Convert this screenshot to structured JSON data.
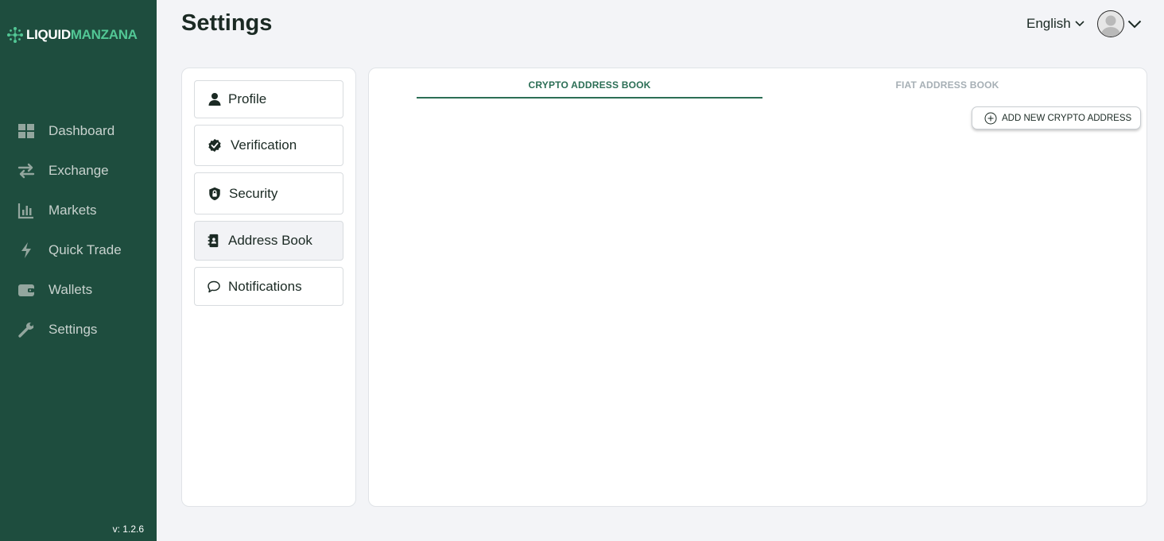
{
  "brand": {
    "part1": "LIQUID",
    "part2": "MANZANA",
    "accent": "#52c795",
    "sidebar_bg": "#1e4d3e"
  },
  "sidebar": {
    "items": [
      {
        "label": "Dashboard",
        "icon": "dashboard-icon"
      },
      {
        "label": "Exchange",
        "icon": "exchange-icon"
      },
      {
        "label": "Markets",
        "icon": "markets-icon"
      },
      {
        "label": "Quick Trade",
        "icon": "lightning-icon"
      },
      {
        "label": "Wallets",
        "icon": "wallet-icon"
      },
      {
        "label": "Settings",
        "icon": "wrench-icon"
      }
    ],
    "version": "v: 1.2.6"
  },
  "header": {
    "title": "Settings",
    "language": "English"
  },
  "settings_menu": {
    "items": [
      {
        "label": "Profile",
        "icon": "user-icon"
      },
      {
        "label": "Verification",
        "icon": "verified-badge-icon"
      },
      {
        "label": "Security",
        "icon": "shield-lock-icon"
      },
      {
        "label": "Address Book",
        "icon": "address-book-icon",
        "active": true
      },
      {
        "label": "Notifications",
        "icon": "chat-bubble-icon"
      }
    ]
  },
  "address_book": {
    "tabs": [
      {
        "label": "CRYPTO ADDRESS BOOK",
        "active": true
      },
      {
        "label": "FIAT ADDRESS BOOK",
        "active": false
      }
    ],
    "add_button_label": "ADD NEW CRYPTO ADDRESS"
  }
}
